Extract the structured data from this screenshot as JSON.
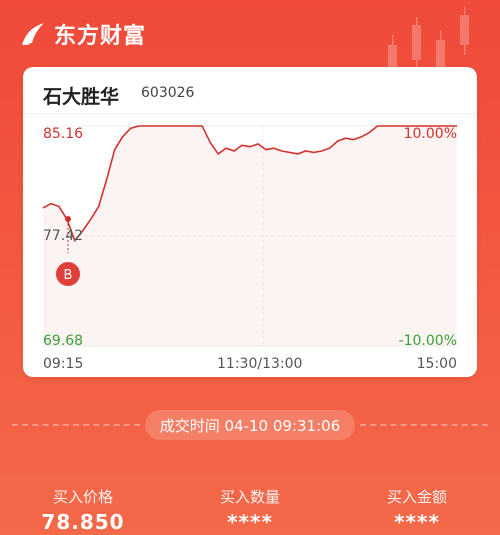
{
  "brand": {
    "name": "东方财富"
  },
  "stock": {
    "name": "石大胜华",
    "code": "603026"
  },
  "chart_data": {
    "type": "line",
    "y_left_ticks": [
      "85.16",
      "77.42",
      "69.68"
    ],
    "y_right_ticks": [
      "10.00%",
      "",
      "-10.00%"
    ],
    "x_ticks": [
      "09:15",
      "11:30/13:00",
      "15:00"
    ],
    "ylim": [
      69.68,
      85.16
    ],
    "buy_marker": "B",
    "x": [
      0,
      1,
      2,
      3,
      4,
      5,
      6,
      7,
      8,
      9,
      10,
      11,
      12,
      13,
      14,
      15,
      16,
      17,
      18,
      19,
      20,
      21,
      22,
      23,
      24,
      25,
      26,
      27,
      28,
      29,
      30,
      31,
      32,
      33,
      34,
      35,
      36,
      37,
      38,
      39,
      40,
      41,
      42,
      43,
      44,
      45,
      46,
      47,
      48,
      49,
      50,
      51,
      52
    ],
    "values": [
      79.4,
      79.7,
      79.5,
      78.6,
      77.1,
      77.8,
      78.6,
      79.5,
      81.4,
      83.5,
      84.4,
      85.0,
      85.16,
      85.16,
      85.16,
      85.16,
      85.16,
      85.16,
      85.16,
      85.16,
      85.16,
      84.0,
      83.2,
      83.6,
      83.4,
      83.8,
      83.7,
      83.9,
      83.5,
      83.6,
      83.4,
      83.3,
      83.2,
      83.4,
      83.3,
      83.4,
      83.6,
      84.1,
      84.3,
      84.2,
      84.4,
      84.7,
      85.16,
      85.16,
      85.16,
      85.16,
      85.16,
      85.16,
      85.16,
      85.16,
      85.16,
      85.16,
      85.16
    ]
  },
  "trade": {
    "time_label": "成交时间 04-10 09:31:06",
    "price_label": "买入价格",
    "price_value": "78.850",
    "qty_label": "买入数量",
    "qty_value": "****",
    "amount_label": "买入金额",
    "amount_value": "****"
  },
  "colors": {
    "background": "#ef4a3a",
    "up": "#d2322d",
    "down": "#3aa23a"
  }
}
